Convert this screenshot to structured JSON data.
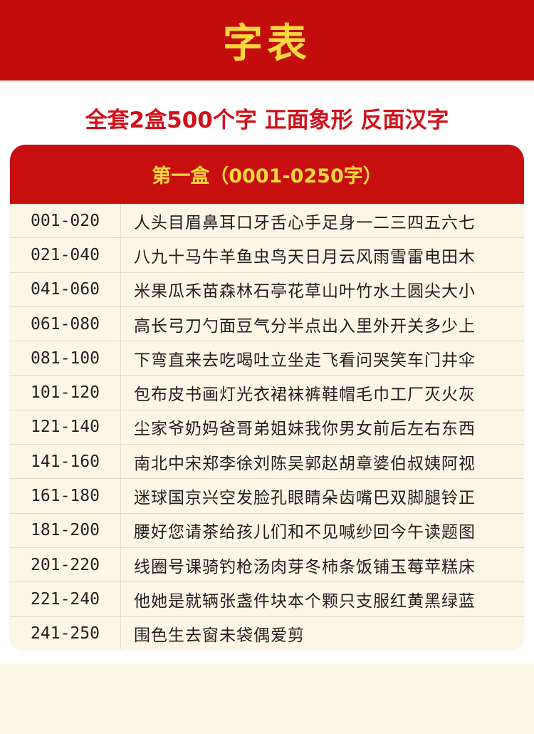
{
  "banner": {
    "title": "字表"
  },
  "subtitle": "全套2盒500个字  正面象形  反面汉字",
  "table": {
    "header": "第一盒（0001-0250字）",
    "rows": [
      {
        "range": "001-020",
        "chars": "人头目眉鼻耳口牙舌心手足身一二三四五六七"
      },
      {
        "range": "021-040",
        "chars": "八九十马牛羊鱼虫鸟天日月云风雨雪雷电田木"
      },
      {
        "range": "041-060",
        "chars": "米果瓜禾苗森林石亭花草山叶竹水土圆尖大小"
      },
      {
        "range": "061-080",
        "chars": "高长弓刀勺面豆气分半点出入里外开关多少上"
      },
      {
        "range": "081-100",
        "chars": "下弯直来去吃喝吐立坐走飞看问哭笑车门井伞"
      },
      {
        "range": "101-120",
        "chars": "包布皮书画灯光衣裙袜裤鞋帽毛巾工厂灭火灰"
      },
      {
        "range": "121-140",
        "chars": "尘家爷奶妈爸哥弟姐妹我你男女前后左右东西"
      },
      {
        "range": "141-160",
        "chars": "南北中宋郑李徐刘陈吴郭赵胡章婆伯叔姨阿视"
      },
      {
        "range": "161-180",
        "chars": "迷球国京兴空发脸孔眼睛朵齿嘴巴双脚腿铃正"
      },
      {
        "range": "181-200",
        "chars": "腰好您请茶给孩儿们和不见喊纱回今午读题图"
      },
      {
        "range": "201-220",
        "chars": "线圈号课骑钓枪汤肉芽冬柿条饭铺玉莓苹糕床"
      },
      {
        "range": "221-240",
        "chars": "他她是就辆张盏件块本个颗只支服红黄黑绿蓝"
      },
      {
        "range": "241-250",
        "chars": "围色生去窗未袋偶爱剪"
      }
    ]
  }
}
